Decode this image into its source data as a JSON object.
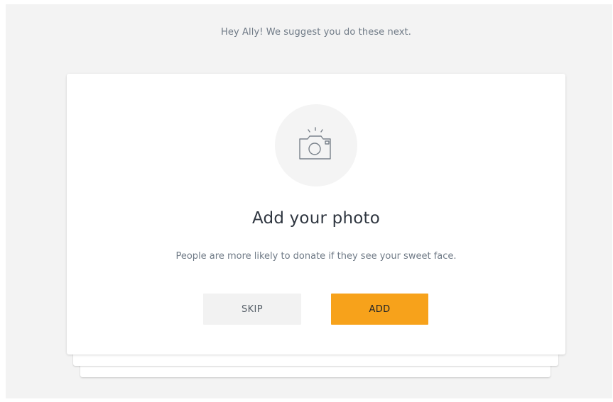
{
  "greeting": "Hey Ally! We suggest you do these next.",
  "card": {
    "icon": "camera-icon",
    "title": "Add your photo",
    "description": "People are more likely to donate if they see your sweet face.",
    "skip_label": "SKIP",
    "add_label": "ADD"
  },
  "colors": {
    "accent": "#f7a21b",
    "background": "#f3f3f3",
    "card": "#ffffff",
    "secondary_button": "#f2f2f2",
    "text_muted": "#6f7a86",
    "text_dark": "#2f3640"
  }
}
